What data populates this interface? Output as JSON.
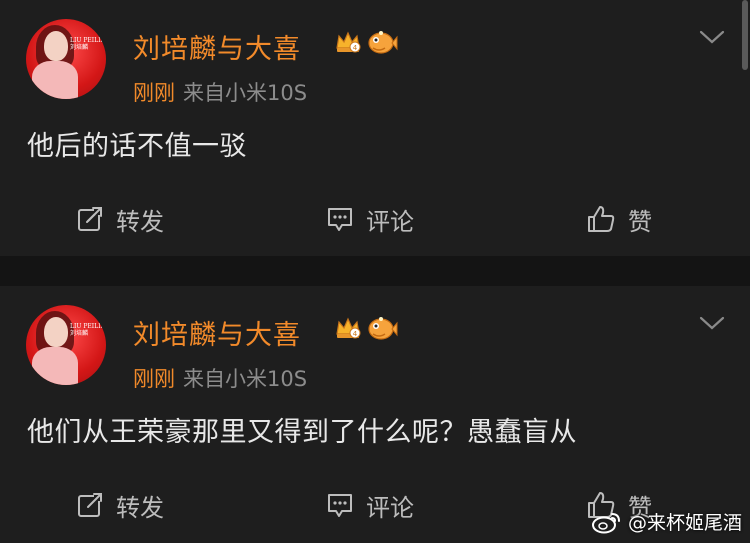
{
  "posts": [
    {
      "author": "刘培麟与大喜",
      "time": "刚刚",
      "source": "来自小米10S",
      "content": "他后的话不值一驳",
      "actions": {
        "repost": "转发",
        "comment": "评论",
        "like": "赞"
      },
      "avatar_text": "LIU PEILIN 刘培麟"
    },
    {
      "author": "刘培麟与大喜",
      "time": "刚刚",
      "source": "来自小米10S",
      "content": "他们从王荣豪那里又得到了什么呢？愚蠢盲从",
      "actions": {
        "repost": "转发",
        "comment": "评论",
        "like": "赞"
      },
      "avatar_text": "LIU PEILIN 刘培麟"
    }
  ],
  "watermark": "@来杯姬尾酒",
  "colors": {
    "accent": "#f28a2a",
    "background": "#1e1e1e",
    "separator": "#141414"
  },
  "icons": [
    "avatar",
    "crown-badge-icon",
    "fish-badge-icon",
    "chevron-down-icon",
    "repost-icon",
    "comment-icon",
    "like-icon",
    "weibo-logo-icon"
  ]
}
